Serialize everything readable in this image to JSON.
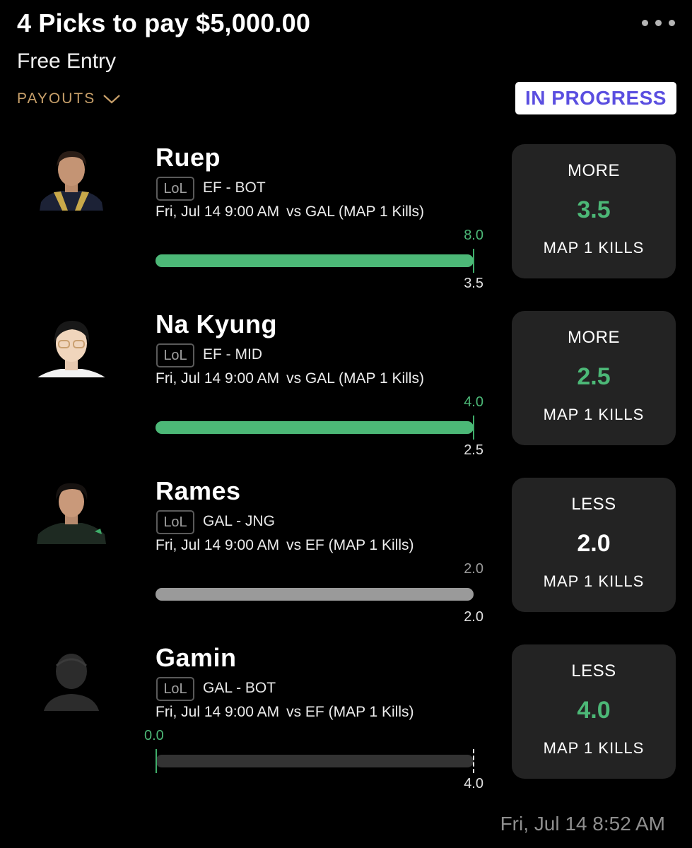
{
  "header": {
    "title": "4 Picks to pay $5,000.00",
    "entry_type": "Free Entry",
    "payouts_label": "PAYOUTS",
    "status": "IN PROGRESS",
    "more_icon": "more-horizontal-icon"
  },
  "colors": {
    "accent_gold": "#c8a06a",
    "status_purple": "#5a4ee0",
    "hit_green": "#4cb877",
    "push_grey": "#9a9a9a",
    "card_bg": "#232323"
  },
  "picks": [
    {
      "name": "Ruep",
      "league": "LoL",
      "team_position": "EF - BOT",
      "game_time": "Fri, Jul 14 9:00 AM",
      "matchup": "vs GAL (MAP 1 Kills)",
      "actual": "8.0",
      "line": "3.5",
      "progress": 1.0,
      "result": "hit",
      "selection": {
        "direction": "MORE",
        "line": "3.5",
        "stat": "MAP 1 KILLS"
      }
    },
    {
      "name": "Na Kyung",
      "league": "LoL",
      "team_position": "EF - MID",
      "game_time": "Fri, Jul 14 9:00 AM",
      "matchup": "vs GAL (MAP 1 Kills)",
      "actual": "4.0",
      "line": "2.5",
      "progress": 1.0,
      "result": "hit",
      "selection": {
        "direction": "MORE",
        "line": "2.5",
        "stat": "MAP 1 KILLS"
      }
    },
    {
      "name": "Rames",
      "league": "LoL",
      "team_position": "GAL - JNG",
      "game_time": "Fri, Jul 14 9:00 AM",
      "matchup": "vs EF (MAP 1 Kills)",
      "actual": "2.0",
      "line": "2.0",
      "progress": 1.0,
      "result": "push",
      "selection": {
        "direction": "LESS",
        "line": "2.0",
        "stat": "MAP 1 KILLS"
      }
    },
    {
      "name": "Gamin",
      "league": "LoL",
      "team_position": "GAL - BOT",
      "game_time": "Fri, Jul 14 9:00 AM",
      "matchup": "vs EF (MAP 1 Kills)",
      "actual": "0.0",
      "line": "4.0",
      "progress": 0.0,
      "result": "pending",
      "selection": {
        "direction": "LESS",
        "line": "4.0",
        "stat": "MAP 1 KILLS"
      }
    }
  ],
  "footer": {
    "timestamp": "Fri, Jul 14 8:52 AM"
  }
}
